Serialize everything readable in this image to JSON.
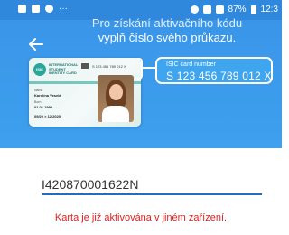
{
  "status_bar": {
    "battery": "87%",
    "time": "12:3",
    "dots": "···"
  },
  "header": {
    "instruction_line1": "Pro získání aktivačního kódu",
    "instruction_line2": "vyplň číslo svého průkazu."
  },
  "card": {
    "logo": "ISIC",
    "brand_line1": "INTERNATIONAL",
    "brand_line2": "STUDENT",
    "brand_line3": "IDENTITY CARD",
    "mini_number": "S 123 456 789 012 X",
    "name_field": "Name",
    "name_value": "Karolína Veselá",
    "born_field": "Born",
    "born_value": "01.01.1999",
    "valid_value": "09/20 > 12/2020"
  },
  "callout": {
    "label": "ISIC card number",
    "number": "S 123 456 789 012 X"
  },
  "form": {
    "card_number_value": "I420870001622N"
  },
  "error": {
    "message": "Karta je již aktivována v jiném zařízení."
  },
  "colors": {
    "primary": "#3a95e8",
    "error": "#e02020",
    "underline": "#1e6fbf"
  }
}
